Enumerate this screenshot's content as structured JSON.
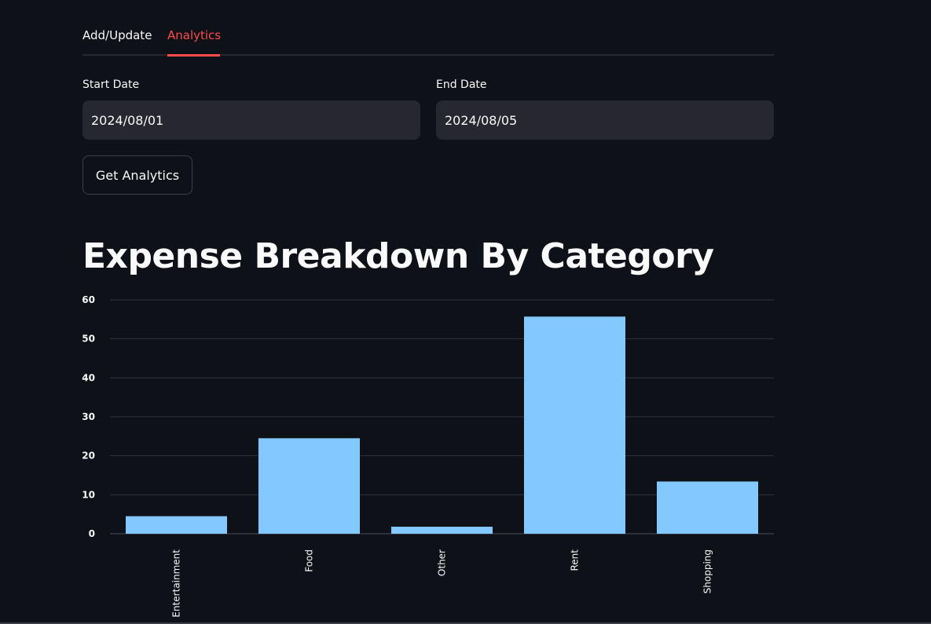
{
  "tabs": [
    {
      "label": "Add/Update",
      "active": false
    },
    {
      "label": "Analytics",
      "active": true
    }
  ],
  "form": {
    "start_date": {
      "label": "Start Date",
      "value": "2024/08/01"
    },
    "end_date": {
      "label": "End Date",
      "value": "2024/08/05"
    },
    "submit_label": "Get Analytics"
  },
  "heading": "Expense Breakdown By Category",
  "colors": {
    "background": "#0e1117",
    "accent": "#ff4b4b",
    "bar": "#83c9ff",
    "input_bg": "#262730",
    "grid": "#31333f"
  },
  "chart_data": {
    "type": "bar",
    "categories": [
      "Entertainment",
      "Food",
      "Other",
      "Rent",
      "Shopping"
    ],
    "values": [
      4.5,
      24.5,
      1.8,
      55.7,
      13.4
    ],
    "ylim": [
      0,
      60
    ],
    "yticks": [
      0,
      10,
      20,
      30,
      40,
      50,
      60
    ],
    "grid": true,
    "xlabel": "",
    "ylabel": "",
    "x_tick_rotation": "vertical"
  }
}
